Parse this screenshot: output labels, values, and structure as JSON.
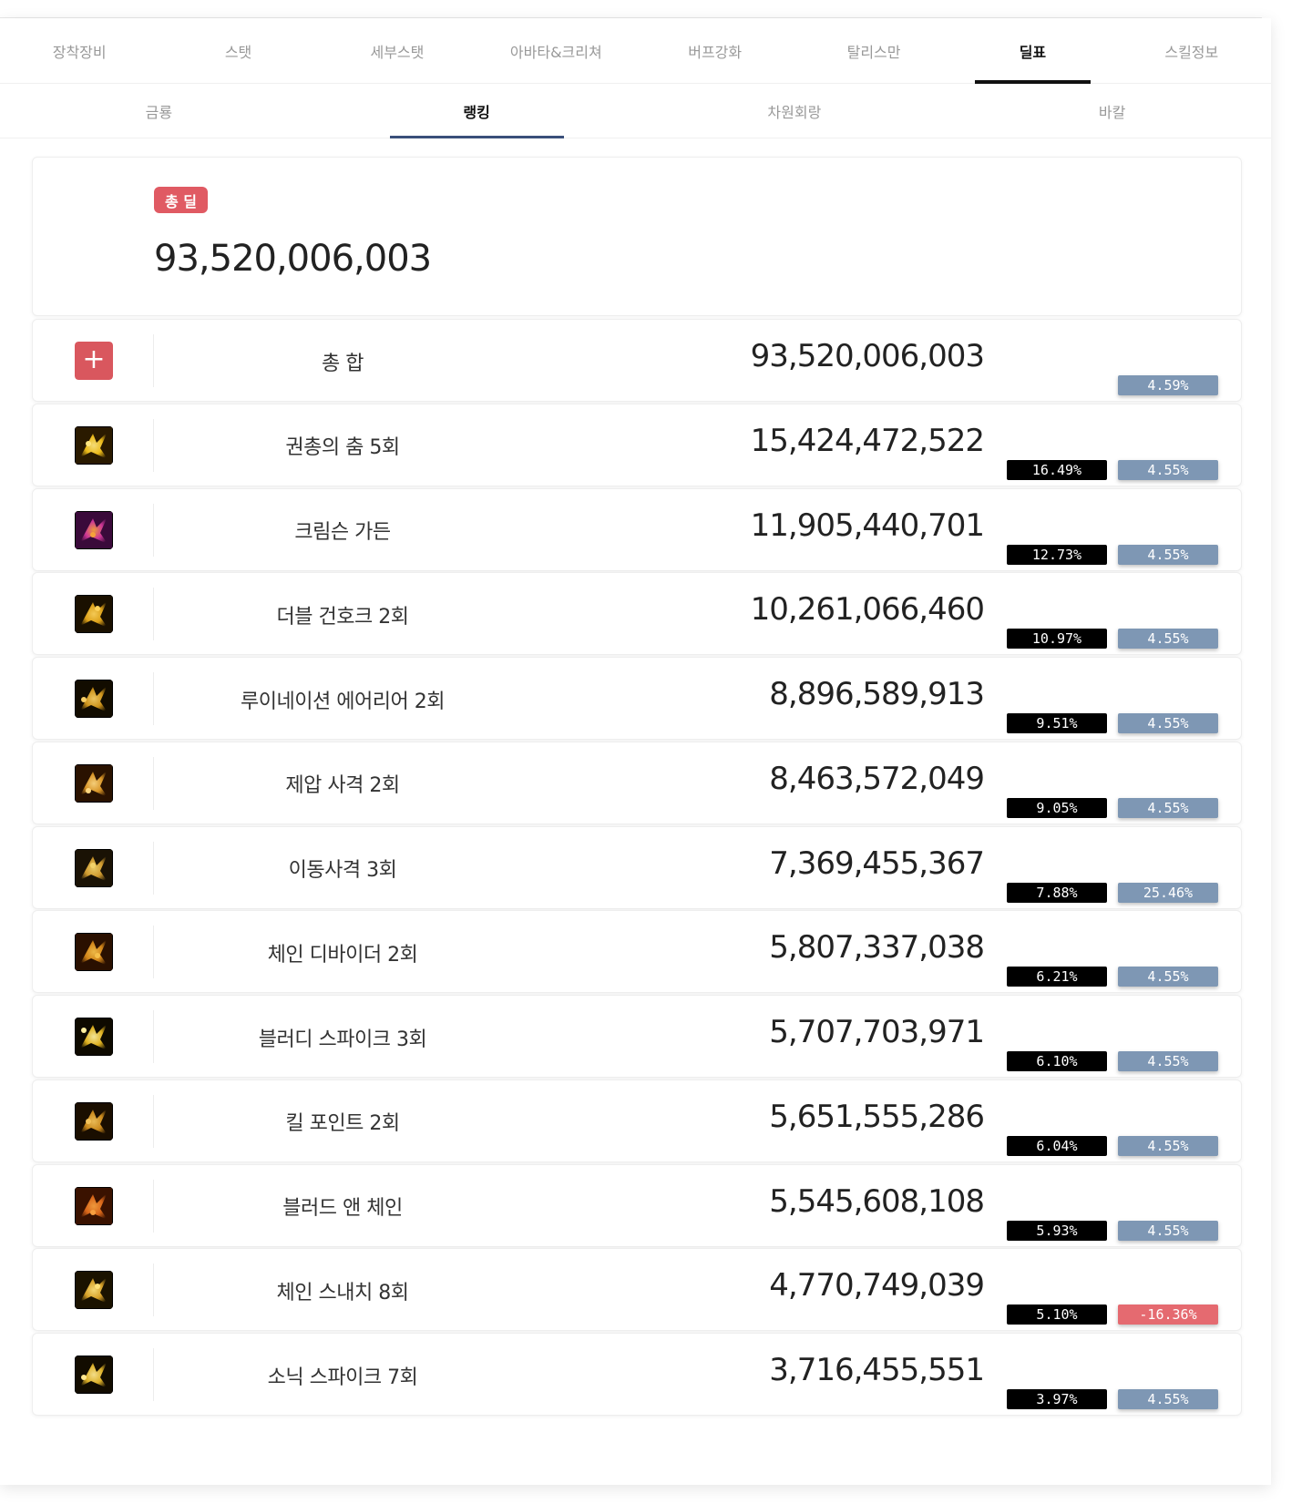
{
  "main_tabs": [
    "장착장비",
    "스탯",
    "세부스탯",
    "아바타&크리쳐",
    "버프강화",
    "탈리스만",
    "딜표",
    "스킬정보"
  ],
  "main_active": 6,
  "sub_tabs": [
    "금룡",
    "랭킹",
    "차원회랑",
    "바칼"
  ],
  "sub_active": 1,
  "total": {
    "badge": "총 딜",
    "value": "93,520,006,003"
  },
  "rows": [
    {
      "icon": "plus-icon",
      "name": "총 합",
      "damage": "93,520,006,003",
      "percent": "",
      "change": "4.59%",
      "change_color": "#7e97b4"
    },
    {
      "icon": "stars-skill-icon",
      "name": "권총의 춤 5회",
      "damage": "15,424,472,522",
      "percent": "16.49%",
      "change": "4.55%",
      "change_color": "#7e97b4"
    },
    {
      "icon": "crimson-skill-icon",
      "name": "크림슨 가든",
      "damage": "11,905,440,701",
      "percent": "12.73%",
      "change": "4.55%",
      "change_color": "#7e97b4"
    },
    {
      "icon": "double-gunhawk-skill-icon",
      "name": "더블 건호크 2회",
      "damage": "10,261,066,460",
      "percent": "10.97%",
      "change": "4.55%",
      "change_color": "#7e97b4"
    },
    {
      "icon": "ruination-skill-icon",
      "name": "루이네이션 에어리어 2회",
      "damage": "8,896,589,913",
      "percent": "9.51%",
      "change": "4.55%",
      "change_color": "#7e97b4"
    },
    {
      "icon": "suppression-skill-icon",
      "name": "제압 사격 2회",
      "damage": "8,463,572,049",
      "percent": "9.05%",
      "change": "4.55%",
      "change_color": "#7e97b4"
    },
    {
      "icon": "moving-shot-skill-icon",
      "name": "이동사격 3회",
      "damage": "7,369,455,367",
      "percent": "7.88%",
      "change": "25.46%",
      "change_color": "#7e97b4"
    },
    {
      "icon": "chain-divider-skill-icon",
      "name": "체인 디바이더 2회",
      "damage": "5,807,337,038",
      "percent": "6.21%",
      "change": "4.55%",
      "change_color": "#7e97b4"
    },
    {
      "icon": "bloody-spike-skill-icon",
      "name": "블러디 스파이크 3회",
      "damage": "5,707,703,971",
      "percent": "6.10%",
      "change": "4.55%",
      "change_color": "#7e97b4"
    },
    {
      "icon": "kill-point-skill-icon",
      "name": "킬 포인트 2회",
      "damage": "5,651,555,286",
      "percent": "6.04%",
      "change": "4.55%",
      "change_color": "#7e97b4"
    },
    {
      "icon": "blood-chain-skill-icon",
      "name": "블러드 앤 체인",
      "damage": "5,545,608,108",
      "percent": "5.93%",
      "change": "4.55%",
      "change_color": "#7e97b4"
    },
    {
      "icon": "chain-snatch-skill-icon",
      "name": "체인 스내치 8회",
      "damage": "4,770,749,039",
      "percent": "5.10%",
      "change": "-16.36%",
      "change_color": "#e56a70"
    },
    {
      "icon": "sonic-spike-skill-icon",
      "name": "소닉 스파이크 7회",
      "damage": "3,716,455,551",
      "percent": "3.97%",
      "change": "4.55%",
      "change_color": "#7e97b4"
    }
  ]
}
